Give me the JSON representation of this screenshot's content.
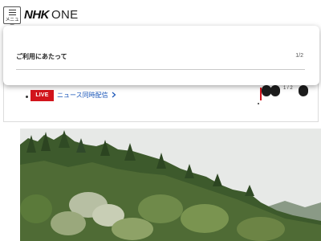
{
  "header": {
    "menu_label": "メニュー",
    "logo_brand": "NHK",
    "logo_suffix": "ONE"
  },
  "modal": {
    "title": "ご利用にあたって",
    "page_indicator": "1/2"
  },
  "live": {
    "badge": "LIVE",
    "link_label": "ニュース同時配信",
    "counter": "1 / 2"
  },
  "colors": {
    "live_red": "#d2141c",
    "link_blue": "#1a56b8"
  },
  "icons": {
    "menu": "hamburger-icon",
    "link_arrow": "chevron-right-icon",
    "carousel_prev": "arrow-left-icon",
    "carousel_next": "arrow-right-icon"
  }
}
